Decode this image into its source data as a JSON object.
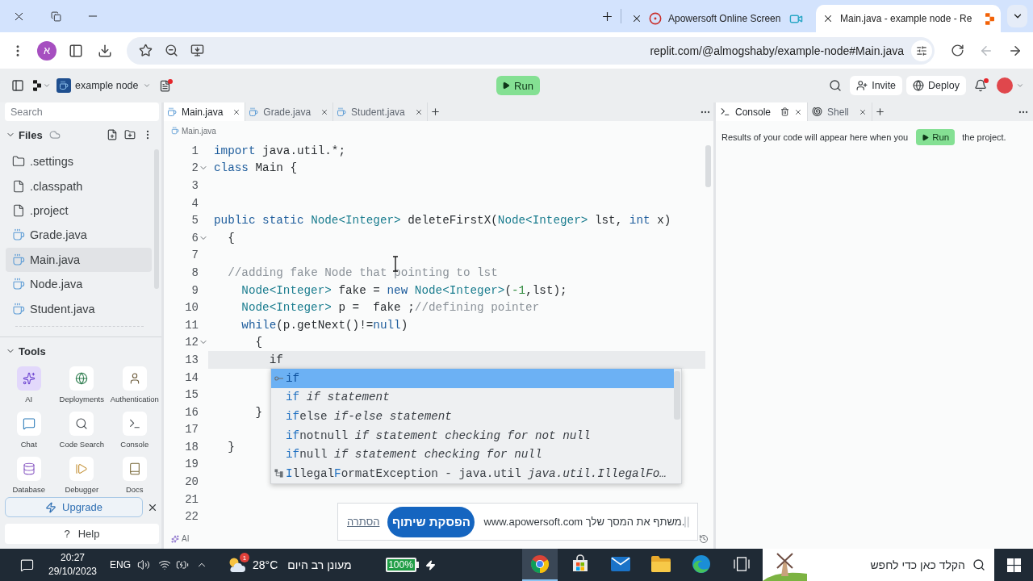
{
  "browser": {
    "tabs": [
      {
        "title": "Apowersoft Online Screen",
        "kind": "recorder",
        "selected": false
      },
      {
        "title": "Main.java - example node - Re",
        "kind": "replit",
        "selected": true
      }
    ],
    "profile_initial": "א",
    "url": "replit.com/@almogshaby/example-node#Main.java",
    "back_disabled": true
  },
  "header": {
    "project_name": "example node",
    "run_label": "Run",
    "actions": [
      {
        "label": "Invite",
        "kind": "invite"
      },
      {
        "label": "Deploy",
        "kind": "deploy"
      }
    ]
  },
  "sidebar": {
    "search": {
      "placeholder": "Search"
    },
    "files_title": "Files",
    "files": [
      {
        "name": ".settings",
        "kind": "folder",
        "selected": false
      },
      {
        "name": ".classpath",
        "kind": "file",
        "selected": false
      },
      {
        "name": ".project",
        "kind": "file",
        "selected": false
      },
      {
        "name": "Grade.java",
        "kind": "java",
        "selected": false
      },
      {
        "name": "Main.java",
        "kind": "java",
        "selected": true
      },
      {
        "name": "Node.java",
        "kind": "java",
        "selected": false
      },
      {
        "name": "Student.java",
        "kind": "java",
        "selected": false
      }
    ],
    "tools_title": "Tools",
    "tools": [
      {
        "label": "AI",
        "kind": "ai",
        "selected": true
      },
      {
        "label": "Deployments",
        "kind": "deployments",
        "selected": false
      },
      {
        "label": "Authentication",
        "kind": "authentication",
        "selected": false
      },
      {
        "label": "Chat",
        "kind": "chat",
        "selected": false
      },
      {
        "label": "Code Search",
        "kind": "code_search",
        "selected": false
      },
      {
        "label": "Console",
        "kind": "console",
        "selected": false
      },
      {
        "label": "Database",
        "kind": "database",
        "selected": false
      },
      {
        "label": "Debugger",
        "kind": "debugger",
        "selected": false
      },
      {
        "label": "Docs",
        "kind": "docs",
        "selected": false
      }
    ],
    "upgrade_label": "Upgrade",
    "help": {
      "icon": "?",
      "label": "Help"
    }
  },
  "editor": {
    "tabs": [
      {
        "label": "Main.java",
        "selected": true
      },
      {
        "label": "Grade.java",
        "selected": false
      },
      {
        "label": "Student.java",
        "selected": false
      }
    ],
    "breadcrumb": "Main.java",
    "lines": [
      {
        "number": "1",
        "fold": false,
        "current": false,
        "tokens": [
          {
            "kind": "keyword",
            "text": "import"
          },
          {
            "kind": "plain",
            "text": " java.util.*;"
          }
        ]
      },
      {
        "number": "2",
        "fold": true,
        "current": false,
        "tokens": [
          {
            "kind": "keyword",
            "text": "class"
          },
          {
            "kind": "plain",
            "text": " Main {"
          }
        ]
      },
      {
        "number": "3",
        "fold": false,
        "current": false
      },
      {
        "number": "4",
        "fold": false,
        "current": false
      },
      {
        "number": "5",
        "fold": false,
        "current": false,
        "tokens": [
          {
            "kind": "keyword",
            "text": "public static "
          },
          {
            "kind": "type",
            "text": "Node<Integer>"
          },
          {
            "kind": "plain",
            "text": " deleteFirstX("
          },
          {
            "kind": "type",
            "text": "Node<Integer>"
          },
          {
            "kind": "plain",
            "text": " lst, "
          },
          {
            "kind": "keyword",
            "text": "int"
          },
          {
            "kind": "plain",
            "text": " x)"
          }
        ]
      },
      {
        "number": "6",
        "fold": true,
        "current": false,
        "tokens": [
          {
            "kind": "plain",
            "text": "  {"
          }
        ]
      },
      {
        "number": "7",
        "fold": false,
        "current": false
      },
      {
        "number": "8",
        "fold": false,
        "current": false,
        "tokens": [
          {
            "kind": "comment",
            "text": "  //adding fake Node that pointing to lst"
          }
        ]
      },
      {
        "number": "9",
        "fold": false,
        "current": false,
        "tokens": [
          {
            "kind": "type",
            "text": "    Node<Integer>"
          },
          {
            "kind": "plain",
            "text": " fake = "
          },
          {
            "kind": "keyword",
            "text": "new "
          },
          {
            "kind": "type",
            "text": "Node<Integer>"
          },
          {
            "kind": "plain",
            "text": "("
          },
          {
            "kind": "number",
            "text": "-1"
          },
          {
            "kind": "plain",
            "text": ",lst);"
          }
        ]
      },
      {
        "number": "10",
        "fold": false,
        "current": false,
        "tokens": [
          {
            "kind": "type",
            "text": "    Node<Integer>"
          },
          {
            "kind": "plain",
            "text": " p =  fake ;"
          },
          {
            "kind": "comment",
            "text": "//defining pointer"
          }
        ]
      },
      {
        "number": "11",
        "fold": false,
        "current": false,
        "tokens": [
          {
            "kind": "keyword",
            "text": "    while"
          },
          {
            "kind": "plain",
            "text": "(p.getNext()!="
          },
          {
            "kind": "keyword",
            "text": "null"
          },
          {
            "kind": "plain",
            "text": ")"
          }
        ]
      },
      {
        "number": "12",
        "fold": true,
        "current": false,
        "tokens": [
          {
            "kind": "plain",
            "text": "      {"
          }
        ]
      },
      {
        "number": "13",
        "fold": false,
        "current": true,
        "tokens": [
          {
            "kind": "plain",
            "text": "        if"
          }
        ]
      },
      {
        "number": "14",
        "fold": false,
        "current": false
      },
      {
        "number": "15",
        "fold": false,
        "current": false
      },
      {
        "number": "16",
        "fold": false,
        "current": false,
        "tokens": [
          {
            "kind": "plain",
            "text": "      }"
          }
        ]
      },
      {
        "number": "17",
        "fold": false,
        "current": false
      },
      {
        "number": "18",
        "fold": false,
        "current": false,
        "tokens": [
          {
            "kind": "plain",
            "text": "  }"
          }
        ]
      },
      {
        "number": "19",
        "fold": false,
        "current": false
      },
      {
        "number": "20",
        "fold": false,
        "current": false
      },
      {
        "number": "21",
        "fold": false,
        "current": false
      },
      {
        "number": "22",
        "fold": false,
        "current": false
      }
    ],
    "suggestions": [
      {
        "kind": "keyword",
        "parts": [
          {
            "text": "if",
            "matched": true
          }
        ],
        "selected": true
      },
      {
        "kind": "snippet",
        "parts": [
          {
            "text": "if",
            "matched": true
          }
        ],
        "detail": "if statement",
        "selected": false
      },
      {
        "kind": "snippet",
        "parts": [
          {
            "text": "if",
            "matched": true
          },
          {
            "text": "else",
            "matched": false
          }
        ],
        "detail": "if-else statement",
        "selected": false
      },
      {
        "kind": "snippet",
        "parts": [
          {
            "text": "if",
            "matched": true
          },
          {
            "text": "notnull",
            "matched": false
          }
        ],
        "detail": "if statement checking for not null",
        "selected": false
      },
      {
        "kind": "snippet",
        "parts": [
          {
            "text": "if",
            "matched": true
          },
          {
            "text": "null",
            "matched": false
          }
        ],
        "detail": "if statement checking for null",
        "selected": false
      },
      {
        "kind": "class",
        "parts": [
          {
            "text": "I",
            "matched": true
          },
          {
            "text": "llegal",
            "matched": false
          },
          {
            "text": "F",
            "matched": true
          },
          {
            "text": "ormatException - java.util",
            "matched": false
          }
        ],
        "detail": "java.util.IllegalFo…",
        "selected": false
      }
    ],
    "status_label": "AI"
  },
  "console": {
    "tabs": [
      {
        "label": "Console",
        "kind": "console",
        "selected": true
      },
      {
        "label": "Shell",
        "kind": "shell",
        "selected": false
      }
    ],
    "message_before": "Results of your code will appear here when you",
    "run_label": "Run",
    "message_after": "the project."
  },
  "share_bar": {
    "message": "www.apowersoft.com משתף את המסך שלך.",
    "stop_label": "הפסקת שיתוף",
    "hide_label": "הסתרה"
  },
  "taskbar": {
    "time": "20:27",
    "date": "29/10/2023",
    "language": "ENG",
    "weather_badge": "1",
    "temperature": "28°C",
    "weather": "מעונן רב היום",
    "battery": "100%",
    "apps": [
      {
        "kind": "chrome",
        "selected": true
      },
      {
        "kind": "store",
        "selected": false
      },
      {
        "kind": "mail",
        "selected": false
      },
      {
        "kind": "explorer",
        "selected": false
      },
      {
        "kind": "edge",
        "selected": false
      },
      {
        "kind": "taskview",
        "selected": false
      }
    ],
    "search": {
      "placeholder": "הקלד כאן כדי לחפש"
    }
  }
}
